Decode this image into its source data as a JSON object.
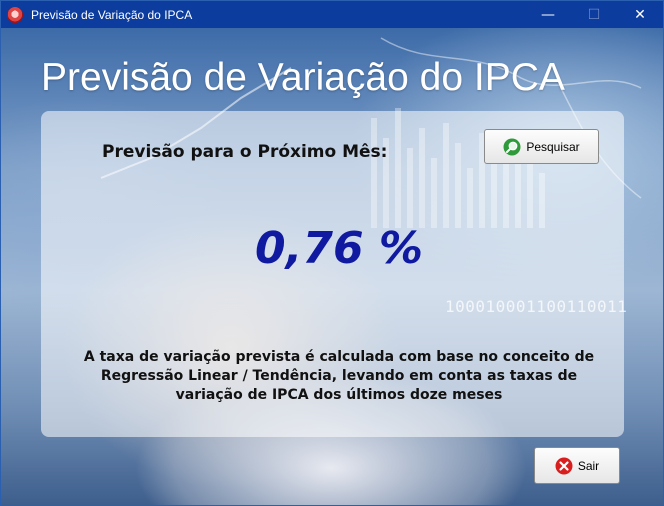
{
  "window": {
    "title": "Previsão de Variação do IPCA",
    "controls": {
      "minimize": "—",
      "maximize": "☐",
      "close": "✕"
    }
  },
  "header": {
    "title": "Previsão de Variação do IPCA"
  },
  "panel": {
    "heading": "Previsão para o Próximo Mês:",
    "search_button": "Pesquisar",
    "forecast_value": "0,76 %",
    "description_lines": [
      "A taxa de variação prevista é calculada com base no conceito de",
      "Regressão Linear / Tendência, levando em conta as taxas de",
      "variação de IPCA dos últimos doze meses"
    ]
  },
  "background": {
    "binary_text": "100010001100110011"
  },
  "footer": {
    "exit_button": "Sair"
  },
  "icons": {
    "search": "search-icon",
    "exit": "close-circle-icon",
    "app": "app-icon"
  },
  "colors": {
    "titlebar": "#0b3c9e",
    "forecast_value": "#0f1aa0",
    "exit_icon": "#d81e1e",
    "search_icon": "#2e9a3a"
  }
}
